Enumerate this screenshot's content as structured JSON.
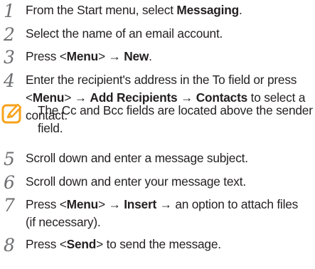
{
  "steps": [
    {
      "number": "1",
      "lines": [
        {
          "segments": [
            {
              "text": "From the Start menu, select ",
              "bold": false
            },
            {
              "text": "Messaging",
              "bold": true
            },
            {
              "text": ".",
              "bold": false
            }
          ]
        }
      ]
    },
    {
      "number": "2",
      "lines": [
        {
          "segments": [
            {
              "text": "Select the name of an email account.",
              "bold": false
            }
          ]
        }
      ]
    },
    {
      "number": "3",
      "lines": [
        {
          "segments": [
            {
              "text": "Press <",
              "bold": false
            },
            {
              "text": "Menu",
              "bold": true
            },
            {
              "text": "> → ",
              "bold": false
            },
            {
              "text": "New",
              "bold": true
            },
            {
              "text": ".",
              "bold": false
            }
          ]
        }
      ]
    },
    {
      "number": "4",
      "lines": [
        {
          "segments": [
            {
              "text": "Enter the recipient's address in the To field or press",
              "bold": false
            }
          ]
        },
        {
          "segments": [
            {
              "text": "<",
              "bold": false
            },
            {
              "text": "Menu",
              "bold": true
            },
            {
              "text": "> → ",
              "bold": false
            },
            {
              "text": "Add Recipients",
              "bold": true
            },
            {
              "text": " → ",
              "bold": false
            },
            {
              "text": "Contacts",
              "bold": true
            },
            {
              "text": " to select a",
              "bold": false
            }
          ]
        },
        {
          "segments": [
            {
              "text": "contact.",
              "bold": false
            }
          ]
        }
      ]
    },
    {
      "number": "5",
      "lines": [
        {
          "segments": [
            {
              "text": "Scroll down and enter a message subject.",
              "bold": false
            }
          ]
        }
      ]
    },
    {
      "number": "6",
      "lines": [
        {
          "segments": [
            {
              "text": "Scroll down and enter your message text.",
              "bold": false
            }
          ]
        }
      ]
    },
    {
      "number": "7",
      "lines": [
        {
          "segments": [
            {
              "text": "Press <",
              "bold": false
            },
            {
              "text": "Menu",
              "bold": true
            },
            {
              "text": "> → ",
              "bold": false
            },
            {
              "text": "Insert",
              "bold": true
            },
            {
              "text": " → an option to attach files",
              "bold": false
            }
          ]
        },
        {
          "segments": [
            {
              "text": "(if necessary).",
              "bold": false
            }
          ]
        }
      ]
    },
    {
      "number": "8",
      "lines": [
        {
          "segments": [
            {
              "text": "Press <",
              "bold": false
            },
            {
              "text": "Send",
              "bold": true
            },
            {
              "text": "> to send the message.",
              "bold": false
            }
          ]
        }
      ]
    }
  ],
  "note": {
    "icon": "note-pencil-icon",
    "lines": [
      "The Cc and Bcc fields are located above the sender",
      "field."
    ]
  },
  "colors": {
    "text": "#231f20",
    "number": "#6d6e71",
    "note_icon": "#f7a21b"
  }
}
